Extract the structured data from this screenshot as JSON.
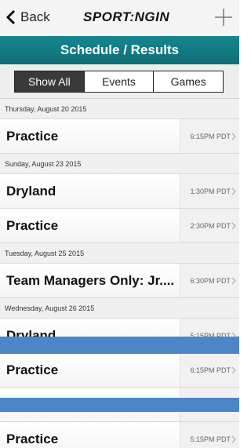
{
  "nav": {
    "back_label": "Back",
    "logo_text": "SPORT:NGIN"
  },
  "title": "Schedule / Results",
  "segments": [
    "Show All",
    "Events",
    "Games"
  ],
  "selected_segment": "Show All",
  "schedule": [
    {
      "date": "Thursday, August 20 2015",
      "events": [
        {
          "title": "Practice",
          "time": "6:15PM PDT"
        }
      ]
    },
    {
      "date": "Sunday, August 23 2015",
      "events": [
        {
          "title": "Dryland",
          "time": "1:30PM PDT"
        },
        {
          "title": "Practice",
          "time": "2:30PM PDT"
        }
      ]
    },
    {
      "date": "Tuesday, August 25 2015",
      "events": [
        {
          "title": "Team Managers Only: Jr....",
          "time": "6:30PM PDT"
        }
      ]
    },
    {
      "date": "Wednesday, August 26 2015",
      "events": [
        {
          "title": "Dryland",
          "time": "5:15PM PDT"
        },
        {
          "title": "Practice",
          "time": "6:15PM PDT"
        },
        {
          "title": "",
          "time": ""
        },
        {
          "title": "Practice",
          "time": "5:15PM PDT"
        }
      ]
    }
  ],
  "colors": {
    "title_bar": "#11797f",
    "overlay_band": "#4b86c7",
    "active_segment": "#3a3a3a"
  }
}
